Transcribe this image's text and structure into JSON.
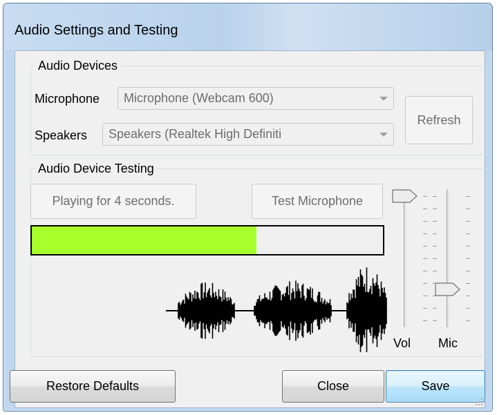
{
  "window": {
    "title": "Audio Settings and Testing"
  },
  "devices": {
    "legend": "Audio Devices",
    "microphone_label": "Microphone",
    "microphone_value": "Microphone (Webcam 600)",
    "speakers_label": "Speakers",
    "speakers_value": "Speakers (Realtek High Definiti",
    "refresh_label": "Refresh"
  },
  "testing": {
    "legend": "Audio Device Testing",
    "play_label": "Playing for 4 seconds.",
    "test_mic_label": "Test Microphone",
    "level_fraction": 0.64,
    "vol_label": "Vol",
    "mic_label": "Mic",
    "vol_level": 1.0,
    "mic_level": 0.25,
    "meter_color": "#a7ff2b"
  },
  "footer": {
    "restore_label": "Restore Defaults",
    "close_label": "Close",
    "save_label": "Save"
  },
  "icons": [
    "chevron-down-icon",
    "slider-thumb-icon",
    "resize-grip-icon",
    "waveform-graphic"
  ]
}
